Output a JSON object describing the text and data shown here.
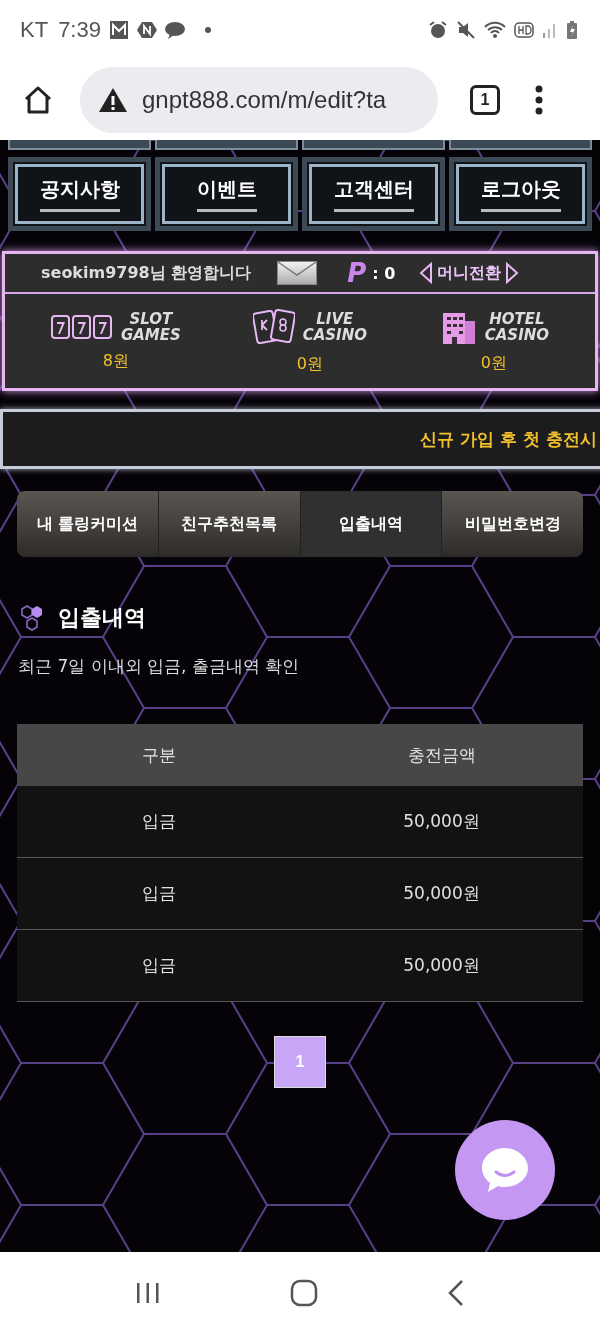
{
  "status_bar": {
    "carrier": "KT",
    "time": "7:39"
  },
  "browser": {
    "url": "gnpt888.com/m/edit?ta",
    "tab_count": "1"
  },
  "top_menu": [
    {
      "label": "공지사항"
    },
    {
      "label": "이벤트"
    },
    {
      "label": "고객센터"
    },
    {
      "label": "로그아웃"
    }
  ],
  "welcome": {
    "greeting": "seokim9798님 환영합니다",
    "points_mark": "P",
    "points": ": 0",
    "money_convert": "머니전환"
  },
  "wallets": [
    {
      "kind": "slot",
      "line1": "SLOT",
      "line2": "GAMES",
      "amount": "8원"
    },
    {
      "kind": "live",
      "line1": "LIVE",
      "line2": "CASINO",
      "amount": "0원"
    },
    {
      "kind": "hotel",
      "line1": "HOTEL",
      "line2": "CASINO",
      "amount": "0원"
    }
  ],
  "marquee": "신규 가입 후 첫 충전시",
  "tabs": [
    {
      "label": "내 롤링커미션",
      "selected": false
    },
    {
      "label": "친구추천목록",
      "selected": false
    },
    {
      "label": "입출내역",
      "selected": true
    },
    {
      "label": "비밀번호변경",
      "selected": false
    }
  ],
  "section": {
    "title": "입출내역",
    "description": "최근 7일 이내외 입금, 출금내역 확인"
  },
  "table": {
    "columns": [
      "구분",
      "충전금액"
    ],
    "rows": [
      [
        "입금",
        "50,000원"
      ],
      [
        "입금",
        "50,000원"
      ],
      [
        "입금",
        "50,000원"
      ]
    ]
  },
  "pagination": [
    {
      "label": "1",
      "selected": true
    }
  ]
}
